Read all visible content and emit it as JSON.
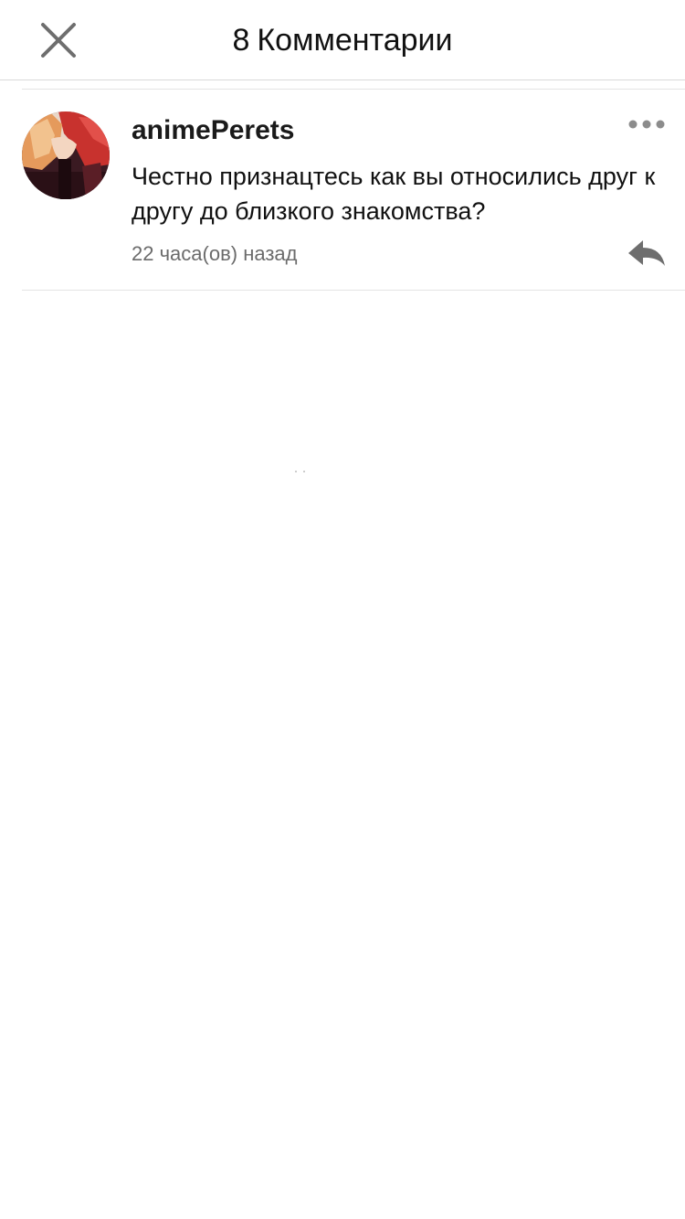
{
  "header": {
    "comment_count": "8",
    "title": "Комментарии",
    "close_icon": "close-icon"
  },
  "comment": {
    "username": "animePerets",
    "text": "Честно признацтесь как вы относились друг к другу до близкого знакомства?",
    "timestamp": "22 часа(ов) назад",
    "more_icon": "more-dots-icon",
    "reply_icon": "reply-arrow-icon"
  },
  "colors": {
    "background": "#ffffff",
    "divider": "#e4e4e4",
    "icon_gray": "#6e6e6e",
    "timestamp_gray": "#6b6b6b"
  }
}
